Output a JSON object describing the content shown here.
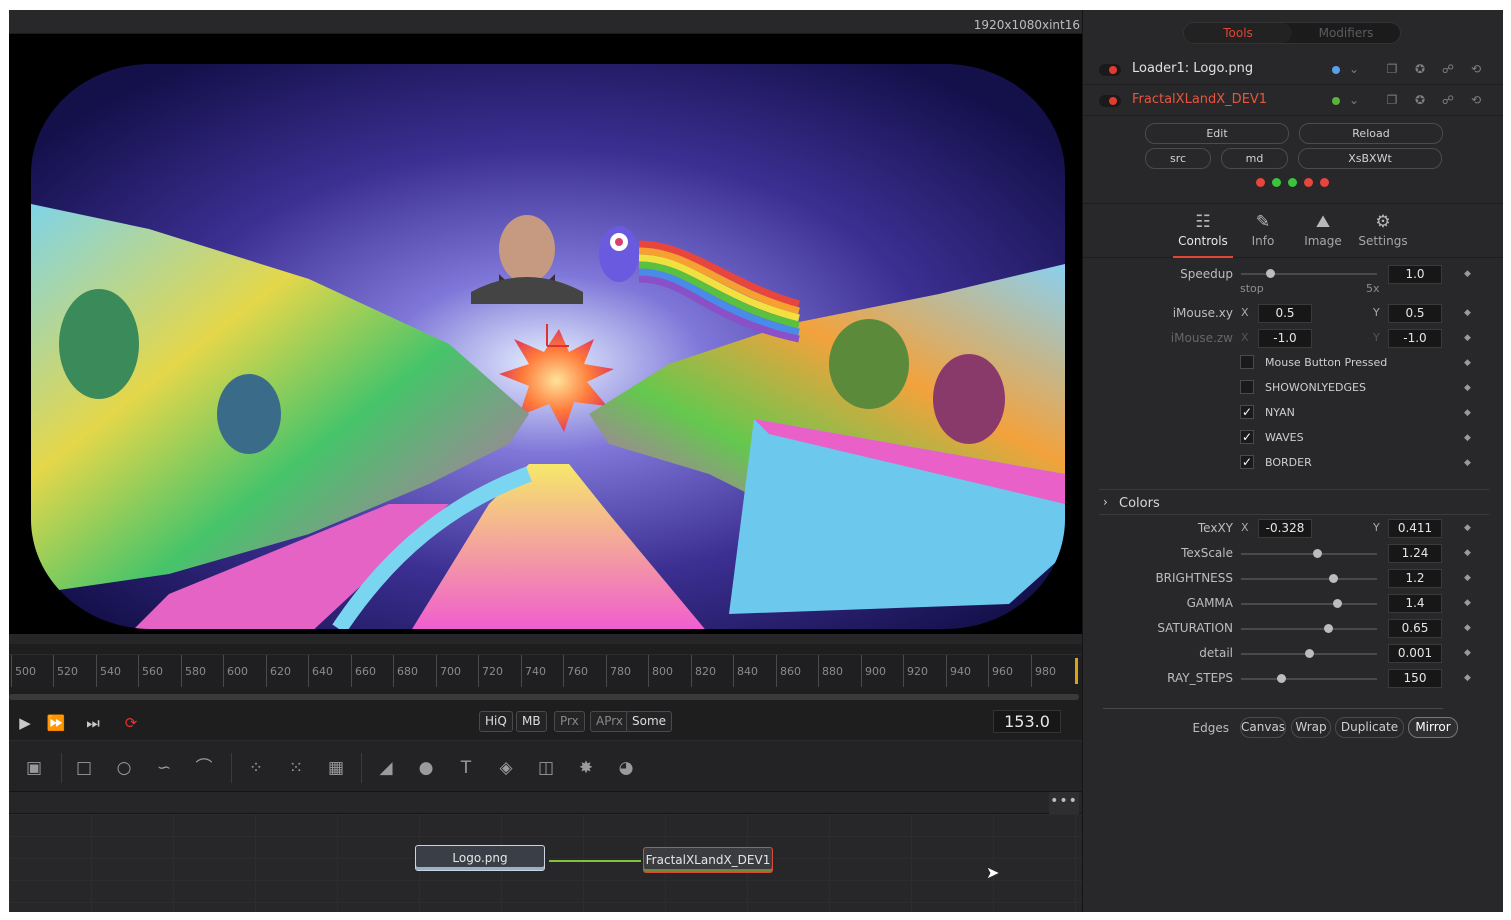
{
  "viewer": {
    "resolution": "1920x1080xint16",
    "ruler_ticks": [
      "500",
      "520",
      "540",
      "560",
      "580",
      "600",
      "620",
      "640",
      "660",
      "680",
      "700",
      "720",
      "740",
      "760",
      "780",
      "800",
      "820",
      "840",
      "860",
      "880",
      "900",
      "920",
      "940",
      "960",
      "980"
    ]
  },
  "transport": {
    "quality_buttons": [
      "HiQ",
      "MB",
      "Prx",
      "APrx",
      "Some"
    ],
    "current_frame": "153.0"
  },
  "nodes": {
    "loader": "Logo.png",
    "fractal": "FractalXLandX_DEV1"
  },
  "inspector": {
    "tabs": {
      "tools": "Tools",
      "modifiers": "Modifiers"
    },
    "tool_rows": [
      {
        "name": "Loader1: Logo.png",
        "dot_color": "#5aa0e8"
      },
      {
        "name": "FractalXLandX_DEV1",
        "dot_color": "#5ab43a"
      }
    ],
    "buttons": {
      "edit": "Edit",
      "reload": "Reload",
      "src": "src",
      "md": "md",
      "xsbxwt": "XsBXWt"
    },
    "label_dots": [
      "#e8453c",
      "#3cc43c",
      "#3cc43c",
      "#e8453c",
      "#e8453c"
    ],
    "control_tabs": {
      "controls": "Controls",
      "info": "Info",
      "image": "Image",
      "settings": "Settings"
    },
    "speedup": {
      "label": "Speedup",
      "value": "1.0",
      "min_label": "stop",
      "max_label": "5x",
      "fraction": 0.22
    },
    "imouse_xy": {
      "label": "iMouse.xy",
      "x_label": "X",
      "x": "0.5",
      "y_label": "Y",
      "y": "0.5"
    },
    "imouse_zw": {
      "label": "iMouse.zw",
      "x_label": "X",
      "x": "-1.0",
      "y_label": "Y",
      "y": "-1.0"
    },
    "checkboxes": [
      {
        "label": "Mouse Button Pressed",
        "checked": false
      },
      {
        "label": "SHOWONLYEDGES",
        "checked": false
      },
      {
        "label": "NYAN",
        "checked": true
      },
      {
        "label": "WAVES",
        "checked": true
      },
      {
        "label": "BORDER",
        "checked": true
      }
    ],
    "colors_section": "Colors",
    "texxy": {
      "label": "TexXY",
      "x_label": "X",
      "x": "-0.328",
      "y_label": "Y",
      "y": "0.411"
    },
    "sliders": [
      {
        "label": "TexScale",
        "value": "1.24",
        "fraction": 0.56
      },
      {
        "label": "BRIGHTNESS",
        "value": "1.2",
        "fraction": 0.68
      },
      {
        "label": "GAMMA",
        "value": "1.4",
        "fraction": 0.71
      },
      {
        "label": "SATURATION",
        "value": "0.65",
        "fraction": 0.64
      },
      {
        "label": "detail",
        "value": "0.001",
        "fraction": 0.5
      },
      {
        "label": "RAY_STEPS",
        "value": "150",
        "fraction": 0.3
      }
    ],
    "edges": {
      "label": "Edges",
      "options": [
        "Canvas",
        "Wrap",
        "Duplicate",
        "Mirror"
      ],
      "selected": "Mirror"
    }
  }
}
